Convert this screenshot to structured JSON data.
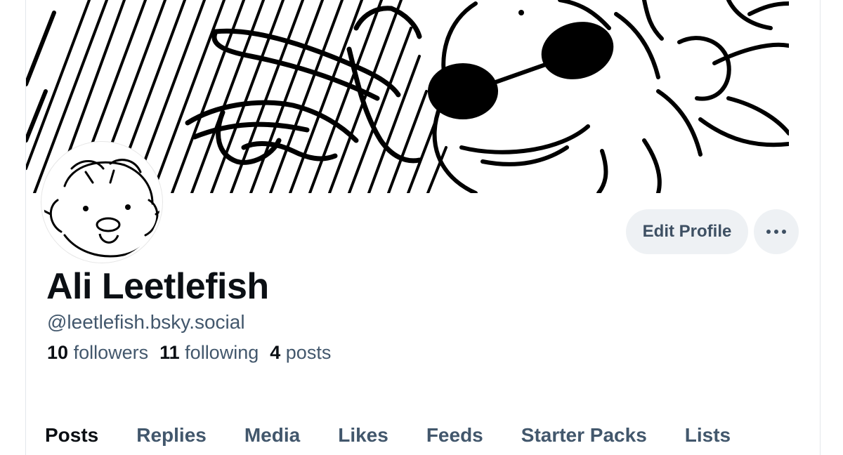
{
  "profile": {
    "display_name": "Ali Leetlefish",
    "handle": "@leetlefish.bsky.social",
    "banner_image": "hand-drawn-character-with-sunglasses-banner",
    "avatar_image": "hand-drawn-character-avatar"
  },
  "stats": {
    "followers_count": "10",
    "followers_label": "followers",
    "following_count": "11",
    "following_label": "following",
    "posts_count": "4",
    "posts_label": "posts"
  },
  "actions": {
    "edit_profile_label": "Edit Profile",
    "more_icon": "ellipsis-icon"
  },
  "tabs": [
    {
      "label": "Posts",
      "active": true
    },
    {
      "label": "Replies",
      "active": false
    },
    {
      "label": "Media",
      "active": false
    },
    {
      "label": "Likes",
      "active": false
    },
    {
      "label": "Feeds",
      "active": false
    },
    {
      "label": "Starter Packs",
      "active": false
    },
    {
      "label": "Lists",
      "active": false
    }
  ],
  "colors": {
    "primary_text": "#0b0f14",
    "secondary_text": "#42576c",
    "button_bg": "#eef1f4"
  }
}
